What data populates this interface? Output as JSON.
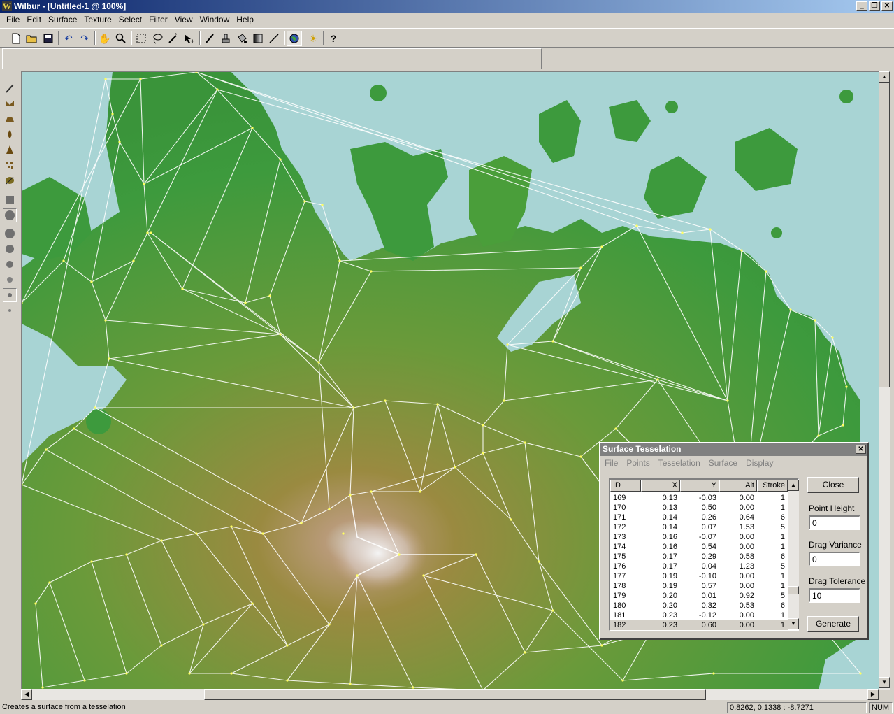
{
  "window": {
    "title": "Wilbur - [Untitled-1 @ 100%]",
    "logo": "W"
  },
  "menubar": [
    "File",
    "Edit",
    "Surface",
    "Texture",
    "Select",
    "Filter",
    "View",
    "Window",
    "Help"
  ],
  "toolbar": [
    "new-icon",
    "open-icon",
    "save-icon",
    "undo-icon",
    "redo-icon",
    "hand-icon",
    "zoom-icon",
    "rect-select-icon",
    "lasso-icon",
    "magic-wand-icon",
    "move-select-icon",
    "brush-icon",
    "stamp-icon",
    "bucket-icon",
    "gradient-icon",
    "line-icon",
    "globe-icon",
    "sun-icon",
    "help-icon"
  ],
  "left_tools": [
    "pencil-tool-icon",
    "valley-tool-icon",
    "plateau-tool-icon",
    "drop-tool-icon",
    "peak-tool-icon",
    "noise-tool-icon",
    "texture-tool-icon",
    "square-brush-icon",
    "brush-size-1-icon",
    "brush-size-2-icon",
    "brush-size-3-icon",
    "brush-size-4-icon",
    "brush-size-5-icon",
    "brush-size-6-icon",
    "brush-size-7-icon"
  ],
  "map": {
    "water": "#a8d4d4",
    "lowland": "#3d9a3d",
    "highland": "#9a8a40",
    "peak": "#f0f0f0",
    "line": "#ffffff",
    "vertex": "#ffff60"
  },
  "dialog": {
    "title": "Surface Tesselation",
    "close_glyph": "✕",
    "menu": [
      "File",
      "Points",
      "Tesselation",
      "Surface",
      "Display"
    ],
    "columns": [
      "ID",
      "X",
      "Y",
      "Alt",
      "Stroke"
    ],
    "rows": [
      [
        "169",
        "0.13",
        "-0.03",
        "0.00",
        "1"
      ],
      [
        "170",
        "0.13",
        "0.50",
        "0.00",
        "1"
      ],
      [
        "171",
        "0.14",
        "0.26",
        "0.64",
        "6"
      ],
      [
        "172",
        "0.14",
        "0.07",
        "1.53",
        "5"
      ],
      [
        "173",
        "0.16",
        "-0.07",
        "0.00",
        "1"
      ],
      [
        "174",
        "0.16",
        "0.54",
        "0.00",
        "1"
      ],
      [
        "175",
        "0.17",
        "0.29",
        "0.58",
        "6"
      ],
      [
        "176",
        "0.17",
        "0.04",
        "1.23",
        "5"
      ],
      [
        "177",
        "0.19",
        "-0.10",
        "0.00",
        "1"
      ],
      [
        "178",
        "0.19",
        "0.57",
        "0.00",
        "1"
      ],
      [
        "179",
        "0.20",
        "0.01",
        "0.92",
        "5"
      ],
      [
        "180",
        "0.20",
        "0.32",
        "0.53",
        "6"
      ],
      [
        "181",
        "0.23",
        "-0.12",
        "0.00",
        "1"
      ],
      [
        "182",
        "0.23",
        "0.60",
        "0.00",
        "1"
      ]
    ],
    "selected_row_index": 13,
    "close_button": "Close",
    "point_height_label": "Point Height",
    "point_height_value": "0",
    "drag_variance_label": "Drag Variance",
    "drag_variance_value": "0",
    "drag_tolerance_label": "Drag Tolerance",
    "drag_tolerance_value": "10",
    "generate_button": "Generate"
  },
  "status": {
    "message": "Creates a surface from a tesselation",
    "coords": "0.8262, 0.1338 : -8.7271",
    "num": "NUM"
  }
}
